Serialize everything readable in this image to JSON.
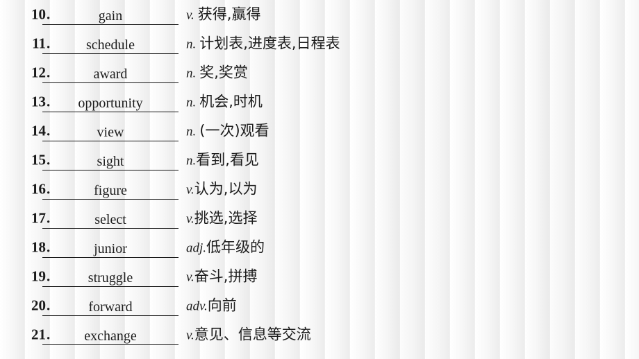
{
  "slide": {
    "kind": "vocabulary-worksheet-slide",
    "background_stripe_color": "#ededed",
    "text_color": "#1c1c1c",
    "rule_color": "#111111"
  },
  "entries": [
    {
      "number": "10",
      "dot": ".",
      "word": "gain",
      "pos": "v.",
      "space_after_pos": true,
      "meaning": "获得,赢得"
    },
    {
      "number": "11",
      "dot": ".",
      "word": "schedule",
      "pos": "n.",
      "space_after_pos": true,
      "meaning": "计划表,进度表,日程表"
    },
    {
      "number": "12",
      "dot": ".",
      "word": "award",
      "pos": "n.",
      "space_after_pos": true,
      "meaning": "奖,奖赏"
    },
    {
      "number": "13",
      "dot": ".",
      "word": "opportunity",
      "pos": "n.",
      "space_after_pos": true,
      "meaning": "机会,时机"
    },
    {
      "number": "14",
      "dot": ".",
      "word": "view",
      "pos": "n.",
      "space_after_pos": true,
      "meaning": "(一次)观看"
    },
    {
      "number": "15",
      "dot": ".",
      "word": "sight",
      "pos": "n.",
      "space_after_pos": false,
      "meaning": "看到,看见"
    },
    {
      "number": "16",
      "dot": ".",
      "word": "figure",
      "pos": "v.",
      "space_after_pos": false,
      "meaning": "认为,以为"
    },
    {
      "number": "17",
      "dot": ".",
      "word": "select",
      "pos": "v.",
      "space_after_pos": false,
      "meaning": "挑选,选择"
    },
    {
      "number": "18",
      "dot": ".",
      "word": "junior",
      "pos": "adj.",
      "space_after_pos": false,
      "meaning": "低年级的"
    },
    {
      "number": "19",
      "dot": ".",
      "word": "struggle",
      "pos": "v.",
      "space_after_pos": false,
      "meaning": "奋斗,拼搏"
    },
    {
      "number": "20",
      "dot": ".",
      "word": "forward",
      "pos": "adv.",
      "space_after_pos": false,
      "meaning": "向前"
    },
    {
      "number": "21",
      "dot": ".",
      "word": "exchange",
      "pos": "v.",
      "space_after_pos": false,
      "meaning": "意见、信息等交流"
    }
  ]
}
